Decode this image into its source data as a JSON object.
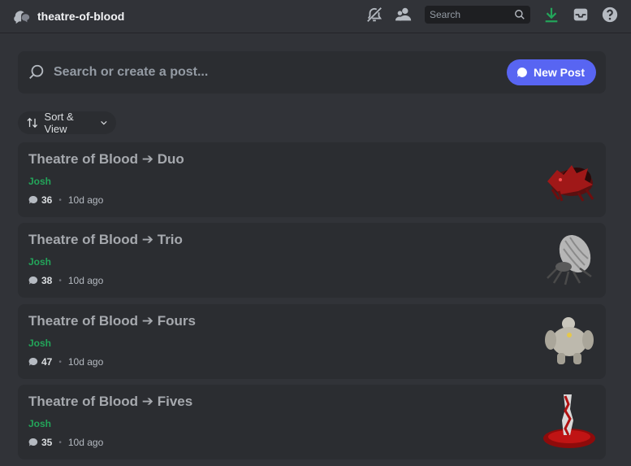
{
  "header": {
    "channel_name": "theatre-of-blood",
    "search_placeholder": "Search"
  },
  "post_bar": {
    "placeholder": "Search or create a post...",
    "new_post_label": "New Post"
  },
  "sort": {
    "label": "Sort & View"
  },
  "threads": [
    {
      "title": "Theatre of Blood ➔ Duo",
      "author": "Josh",
      "messages": "36",
      "age": "10d ago",
      "thumb": "red-spider-creature"
    },
    {
      "title": "Theatre of Blood ➔ Trio",
      "author": "Josh",
      "messages": "38",
      "age": "10d ago",
      "thumb": "grey-spider-creature"
    },
    {
      "title": "Theatre of Blood ➔ Fours",
      "author": "Josh",
      "messages": "47",
      "age": "10d ago",
      "thumb": "grey-ogre-creature"
    },
    {
      "title": "Theatre of Blood ➔ Fives",
      "author": "Josh",
      "messages": "35",
      "age": "10d ago",
      "thumb": "blood-pillar-creature"
    }
  ],
  "colors": {
    "accent": "#5865f2",
    "author": "#23a55a",
    "download": "#23a55a",
    "background": "#313338",
    "card": "#2b2d31"
  }
}
